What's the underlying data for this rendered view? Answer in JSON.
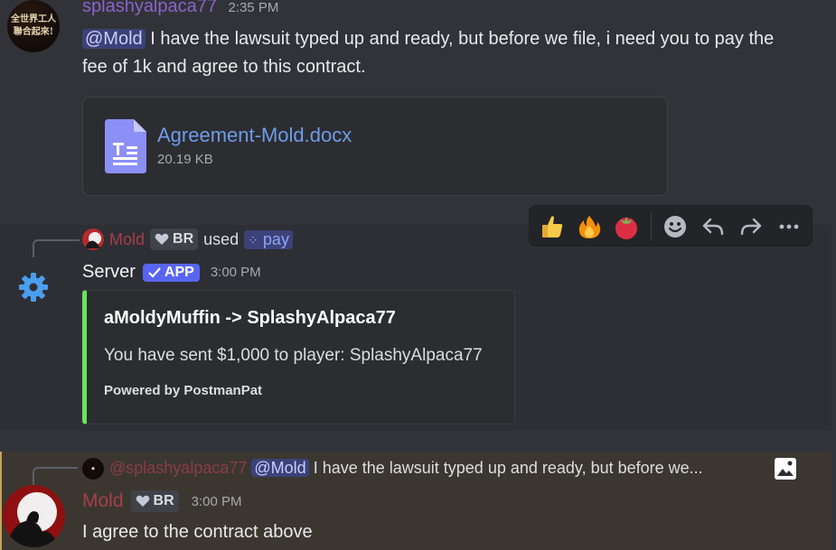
{
  "message1": {
    "author": "splashyalpaca77",
    "timestamp": "2:35 PM",
    "avatar_text": "全世界工人\n聯合起來!",
    "mention": "@Mold",
    "text": " I have the lawsuit typed up and ready, but before we file, i need you to pay the fee of 1k and agree to this contract.",
    "attachment": {
      "name": "Agreement-Mold.docx",
      "size": "20.19 KB"
    }
  },
  "reactions_toolbar": {
    "items": [
      "thumbs-up",
      "fire",
      "tomato",
      "add-reaction",
      "reply",
      "forward",
      "more"
    ]
  },
  "message2": {
    "invoker": "Mold",
    "invoker_role": "BR",
    "used_text": "used",
    "command": "pay",
    "author": "Server",
    "app_badge": "APP",
    "timestamp": "3:00 PM",
    "embed": {
      "title": "aMoldyMuffin -> SplashyAlpaca77",
      "description": "You have sent $1,000 to player: SplashyAlpaca77",
      "footer": "Powered by PostmanPat",
      "color": "#6ae35b"
    }
  },
  "message3": {
    "reply_author": "@splashyalpaca77",
    "reply_mention": "@Mold",
    "reply_preview": "I have the lawsuit typed up and ready, but before we...",
    "author": "Mold",
    "role": "BR",
    "timestamp": "3:00 PM",
    "text": "I agree to the contract above"
  },
  "colors": {
    "background": "#323339",
    "mention_highlight": "#3b3730",
    "accent": "#5865f2"
  }
}
